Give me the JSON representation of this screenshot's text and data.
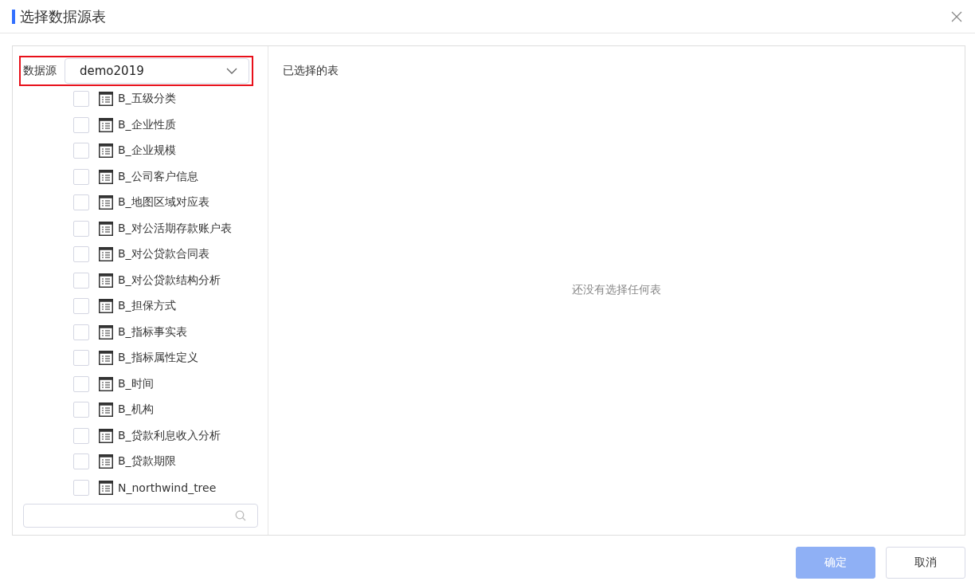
{
  "dialog": {
    "title": "选择数据源表"
  },
  "datasource": {
    "label": "数据源",
    "value": "demo2019",
    "highlighted": true
  },
  "tables": [
    {
      "name": "B_五级分类",
      "checked": false
    },
    {
      "name": "B_企业性质",
      "checked": false
    },
    {
      "name": "B_企业规模",
      "checked": false
    },
    {
      "name": "B_公司客户信息",
      "checked": false
    },
    {
      "name": "B_地图区域对应表",
      "checked": false
    },
    {
      "name": "B_对公活期存款账户表",
      "checked": false
    },
    {
      "name": "B_对公贷款合同表",
      "checked": false
    },
    {
      "name": "B_对公贷款结构分析",
      "checked": false
    },
    {
      "name": "B_担保方式",
      "checked": false
    },
    {
      "name": "B_指标事实表",
      "checked": false
    },
    {
      "name": "B_指标属性定义",
      "checked": false
    },
    {
      "name": "B_时间",
      "checked": false
    },
    {
      "name": "B_机构",
      "checked": false
    },
    {
      "name": "B_贷款利息收入分析",
      "checked": false
    },
    {
      "name": "B_贷款期限",
      "checked": false
    },
    {
      "name": "N_northwind_tree",
      "checked": false
    }
  ],
  "selected_panel": {
    "title": "已选择的表",
    "empty_text": "还没有选择任何表"
  },
  "buttons": [
    {
      "label": "确定",
      "kind": "primary",
      "disabled": true
    },
    {
      "label": "取消",
      "kind": "default",
      "disabled": false
    }
  ]
}
